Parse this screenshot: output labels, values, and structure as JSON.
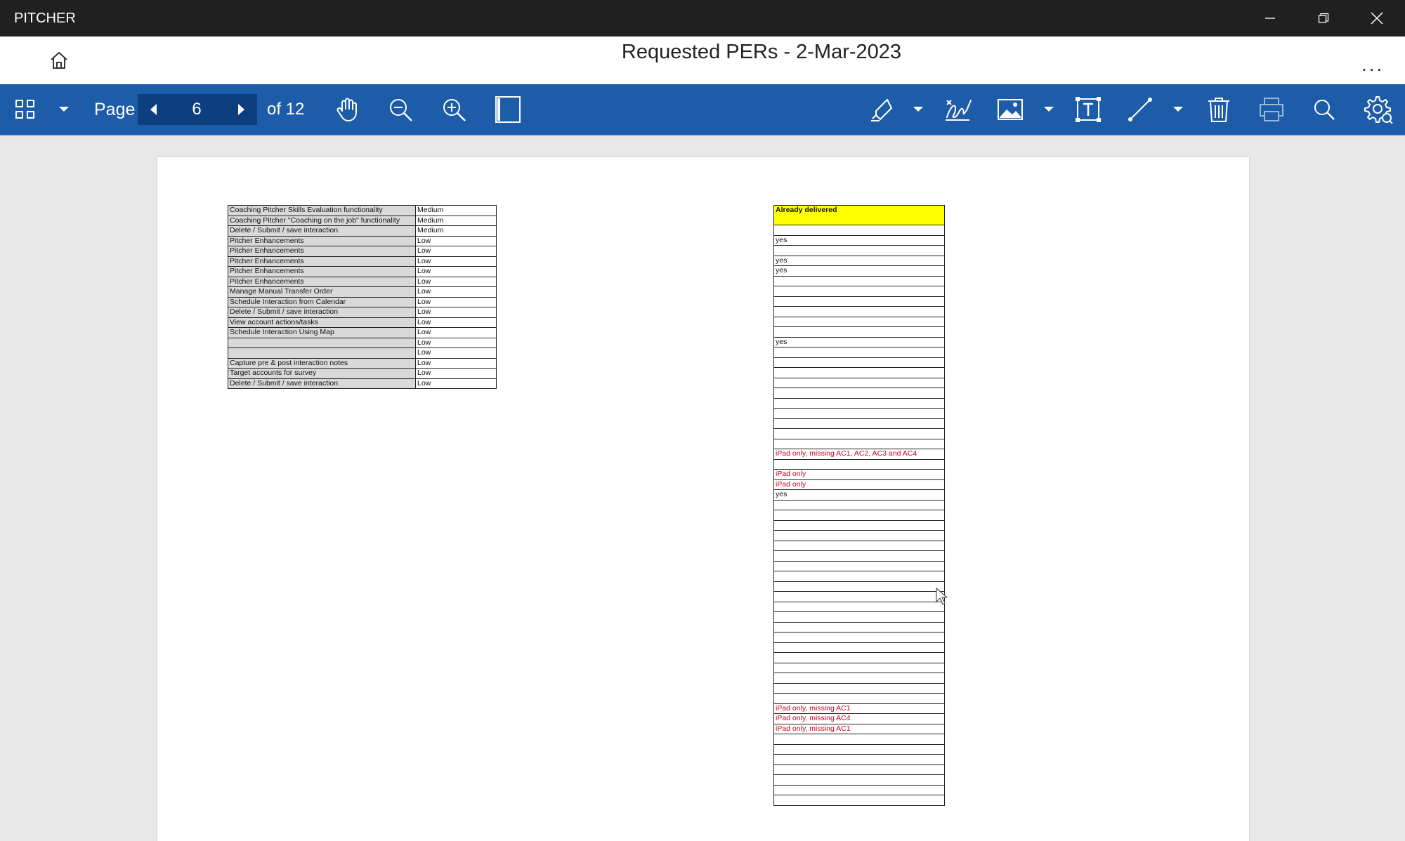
{
  "window": {
    "app_name": "PITCHER",
    "buttons": [
      "minimize",
      "restore",
      "close"
    ]
  },
  "header": {
    "title": "Requested PERs - 2-Mar-2023",
    "more_label": "..."
  },
  "toolbar": {
    "page_label": "Page",
    "current_page": "6",
    "of_label": "of 12",
    "icons": [
      "thumbnails-icon",
      "dropdown-icon",
      "prev-page-icon",
      "next-page-icon",
      "hand-icon",
      "zoom-out-icon",
      "zoom-in-icon",
      "fit-page-icon",
      "highlighter-icon",
      "dropdown-icon",
      "signature-icon",
      "image-icon",
      "dropdown-icon",
      "text-box-icon",
      "line-icon",
      "dropdown-icon",
      "trash-icon",
      "print-icon",
      "search-icon",
      "settings-icon"
    ]
  },
  "document": {
    "left_rows": [
      {
        "name": "Coaching Pitcher Skills Evaluation functionality",
        "priority": "Medium"
      },
      {
        "name": "Coaching Pitcher \"Coaching on the job\" functionality",
        "priority": "Medium"
      },
      {
        "name": "Delete / Submit / save interaction",
        "priority": "Medium"
      },
      {
        "name": "Pitcher Enhancements",
        "priority": "Low"
      },
      {
        "name": "Pitcher Enhancements",
        "priority": "Low"
      },
      {
        "name": "Pitcher Enhancements",
        "priority": "Low"
      },
      {
        "name": "Pitcher Enhancements",
        "priority": "Low"
      },
      {
        "name": "Pitcher Enhancements",
        "priority": "Low"
      },
      {
        "name": "Manage Manual Transfer Order",
        "priority": "Low"
      },
      {
        "name": "Schedule Interaction from Calendar",
        "priority": "Low"
      },
      {
        "name": "Delete / Submit / save interaction",
        "priority": "Low"
      },
      {
        "name": "View account actions/tasks",
        "priority": "Low"
      },
      {
        "name": "Schedule Interaction Using Map",
        "priority": "Low"
      },
      {
        "name": "",
        "priority": "Low"
      },
      {
        "name": "",
        "priority": "Low"
      },
      {
        "name": "Capture pre & post interaction notes",
        "priority": "Low"
      },
      {
        "name": "Target accounts for survey",
        "priority": "Low"
      },
      {
        "name": "Delete / Submit / save interaction",
        "priority": "Low"
      }
    ],
    "right_header": "Already delivered",
    "right_rows": [
      {
        "text": "",
        "red": false
      },
      {
        "text": "yes",
        "red": false
      },
      {
        "text": "",
        "red": false
      },
      {
        "text": "yes",
        "red": false
      },
      {
        "text": "yes",
        "red": false
      },
      {
        "text": "",
        "red": false
      },
      {
        "text": "",
        "red": false
      },
      {
        "text": "",
        "red": false
      },
      {
        "text": "",
        "red": false
      },
      {
        "text": "",
        "red": false
      },
      {
        "text": "",
        "red": false
      },
      {
        "text": "yes",
        "red": false
      },
      {
        "text": "",
        "red": false
      },
      {
        "text": "",
        "red": false
      },
      {
        "text": "",
        "red": false
      },
      {
        "text": "",
        "red": false
      },
      {
        "text": "",
        "red": false
      },
      {
        "text": "",
        "red": false
      },
      {
        "text": "",
        "red": false
      },
      {
        "text": "",
        "red": false
      },
      {
        "text": "",
        "red": false
      },
      {
        "text": "",
        "red": false
      },
      {
        "text": "iPad only, missing AC1, AC2, AC3 and AC4",
        "red": true
      },
      {
        "text": "",
        "red": false
      },
      {
        "text": "iPad only",
        "red": true
      },
      {
        "text": "iPad only",
        "red": true
      },
      {
        "text": "yes",
        "red": false
      },
      {
        "text": "",
        "red": false
      },
      {
        "text": "",
        "red": false
      },
      {
        "text": "",
        "red": false
      },
      {
        "text": "",
        "red": false
      },
      {
        "text": "",
        "red": false
      },
      {
        "text": "",
        "red": false
      },
      {
        "text": "",
        "red": false
      },
      {
        "text": "",
        "red": false
      },
      {
        "text": "",
        "red": false
      },
      {
        "text": "",
        "red": false
      },
      {
        "text": "",
        "red": false
      },
      {
        "text": "",
        "red": false
      },
      {
        "text": "",
        "red": false
      },
      {
        "text": "",
        "red": false
      },
      {
        "text": "",
        "red": false
      },
      {
        "text": "",
        "red": false
      },
      {
        "text": "",
        "red": false
      },
      {
        "text": "",
        "red": false
      },
      {
        "text": "",
        "red": false
      },
      {
        "text": "",
        "red": false
      },
      {
        "text": "iPad only, missing AC1",
        "red": true
      },
      {
        "text": "iPad only, missing AC4",
        "red": true
      },
      {
        "text": "iPad only, missing AC1",
        "red": true
      },
      {
        "text": "",
        "red": false
      },
      {
        "text": "",
        "red": false
      },
      {
        "text": "",
        "red": false
      },
      {
        "text": "",
        "red": false
      },
      {
        "text": "",
        "red": false
      },
      {
        "text": "",
        "red": false
      },
      {
        "text": "",
        "red": false
      }
    ]
  }
}
